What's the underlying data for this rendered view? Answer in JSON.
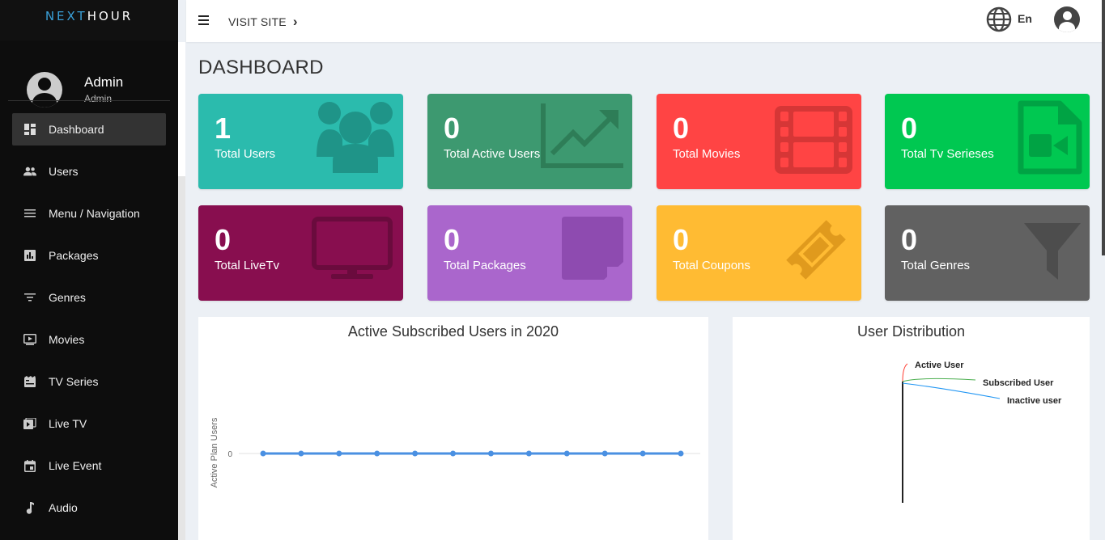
{
  "brand": {
    "prefix": "NEXT",
    "suffix": "HOUR"
  },
  "user": {
    "name": "Admin",
    "role": "Admin"
  },
  "sidebar": {
    "items": [
      {
        "label": "Dashboard",
        "icon": "dashboard-icon",
        "active": true
      },
      {
        "label": "Users",
        "icon": "users-icon"
      },
      {
        "label": "Menu / Navigation",
        "icon": "menu-icon"
      },
      {
        "label": "Packages",
        "icon": "packages-icon"
      },
      {
        "label": "Genres",
        "icon": "genres-icon"
      },
      {
        "label": "Movies",
        "icon": "movies-icon"
      },
      {
        "label": "TV Series",
        "icon": "tv-series-icon"
      },
      {
        "label": "Live TV",
        "icon": "live-tv-icon"
      },
      {
        "label": "Live Event",
        "icon": "live-event-icon"
      },
      {
        "label": "Audio",
        "icon": "audio-icon"
      }
    ]
  },
  "topbar": {
    "visit_label": "VISIT SITE",
    "visit_chevron": "›",
    "language": "En"
  },
  "page": {
    "title": "DASHBOARD"
  },
  "cards": [
    {
      "value": "1",
      "label": "Total Users",
      "color": "#2bbbad",
      "icon": "users-group-icon"
    },
    {
      "value": "0",
      "label": "Total Active Users",
      "color": "#3d9970",
      "icon": "trending-up-icon"
    },
    {
      "value": "0",
      "label": "Total Movies",
      "color": "#ff4444",
      "icon": "film-icon"
    },
    {
      "value": "0",
      "label": "Total Tv Serieses",
      "color": "#00c851",
      "icon": "video-file-icon"
    },
    {
      "value": "0",
      "label": "Total LiveTv",
      "color": "#880e4f",
      "icon": "monitor-icon"
    },
    {
      "value": "0",
      "label": "Total Packages",
      "color": "#aa66cc",
      "icon": "note-icon"
    },
    {
      "value": "0",
      "label": "Total Coupons",
      "color": "#ffbb33",
      "icon": "ticket-icon"
    },
    {
      "value": "0",
      "label": "Total Genres",
      "color": "#616161",
      "icon": "filter-icon"
    }
  ],
  "chart_data": [
    {
      "type": "line",
      "title": "Active Subscribed Users in 2020",
      "ylabel": "Active Plan Users",
      "xlabel": "",
      "yticks": [
        "0"
      ],
      "points": [
        0,
        0,
        0,
        0,
        0,
        0,
        0,
        0,
        0,
        0,
        0,
        0
      ],
      "series_color": "#4a90e2"
    },
    {
      "type": "pie",
      "title": "User Distribution",
      "labels": [
        "Active User",
        "Subscribed User",
        "Inactive user"
      ],
      "colors": [
        "#ff3b30",
        "#4caf50",
        "#2196f3"
      ]
    }
  ]
}
